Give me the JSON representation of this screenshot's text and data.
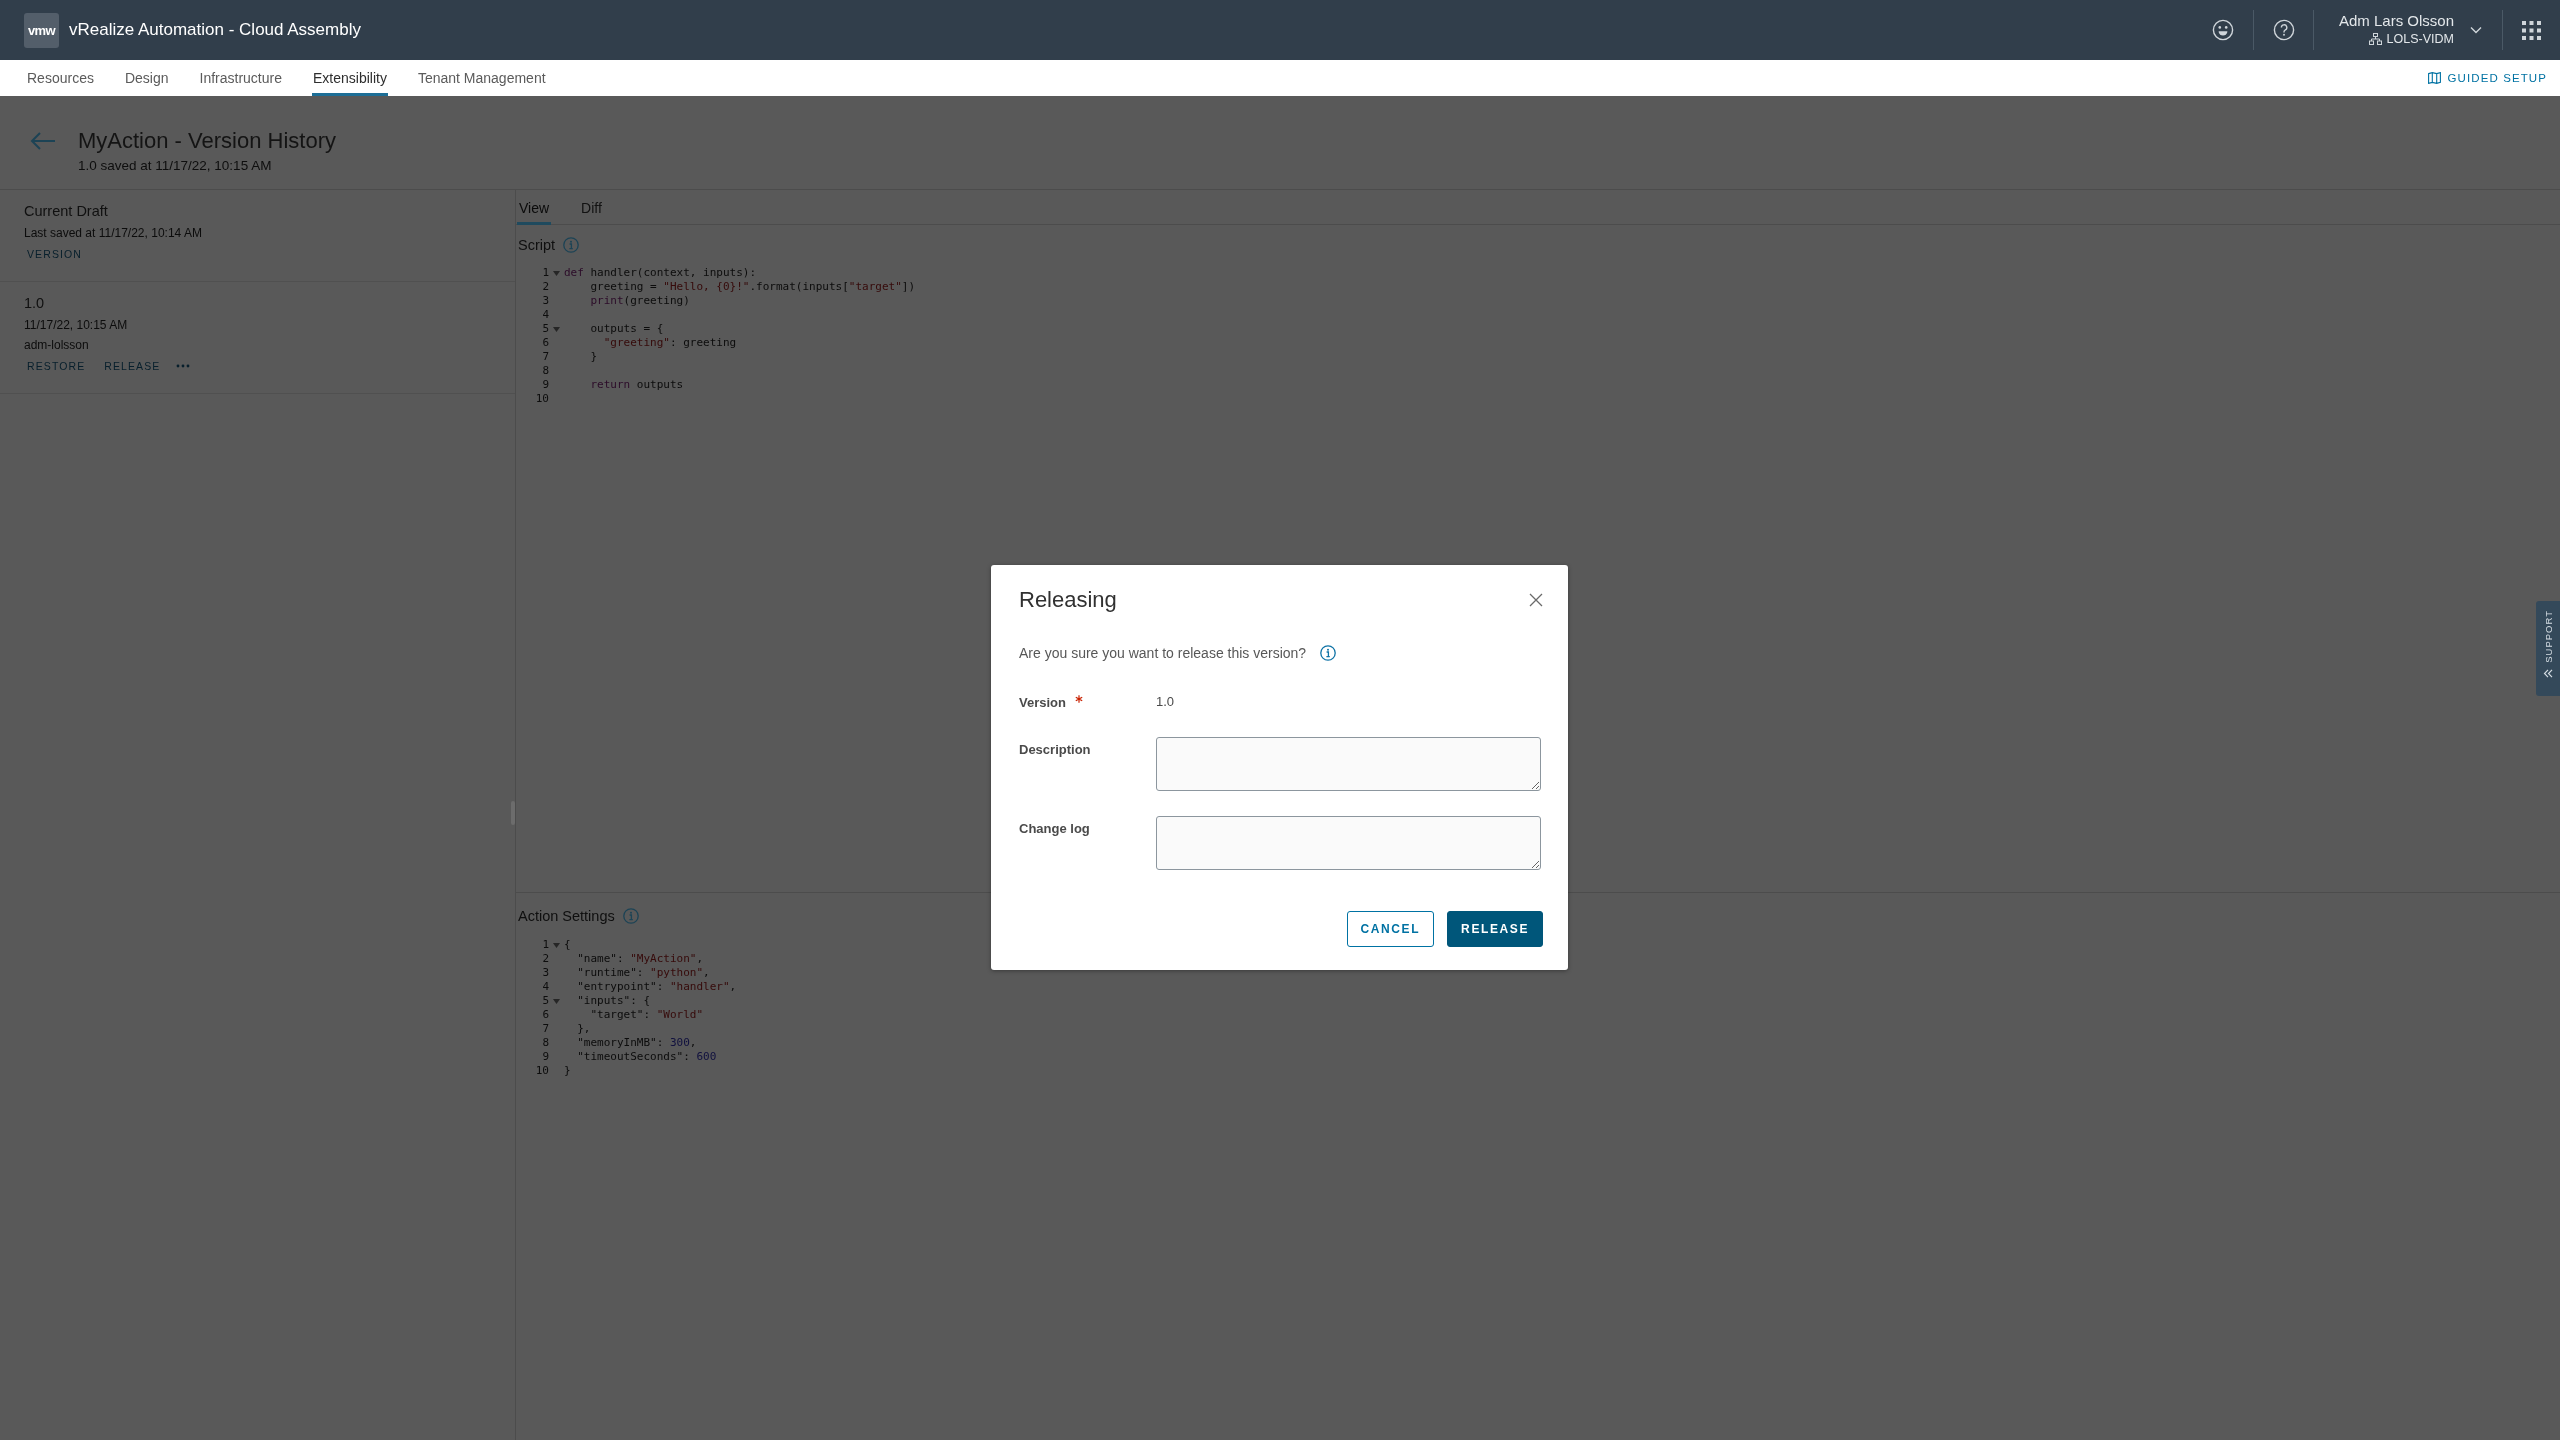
{
  "header": {
    "logo": "vmw",
    "title": "vRealize Automation - Cloud Assembly",
    "user": {
      "name": "Adm Lars Olsson",
      "org": "LOLS-VIDM"
    }
  },
  "nav": {
    "tabs": [
      {
        "label": "Resources",
        "selected": false
      },
      {
        "label": "Design",
        "selected": false
      },
      {
        "label": "Infrastructure",
        "selected": false
      },
      {
        "label": "Extensibility",
        "selected": true
      },
      {
        "label": "Tenant Management",
        "selected": false
      }
    ],
    "guided_setup": "GUIDED SETUP"
  },
  "page": {
    "title": "MyAction - Version History",
    "subtitle": "1.0 saved at 11/17/22, 10:15 AM"
  },
  "versions": [
    {
      "title": "Current Draft",
      "details": [
        "Last saved at 11/17/22, 10:14 AM"
      ],
      "actions": [
        "VERSION"
      ],
      "more": false
    },
    {
      "title": "1.0",
      "details": [
        "11/17/22, 10:15 AM",
        "adm-lolsson"
      ],
      "actions": [
        "RESTORE",
        "RELEASE"
      ],
      "more": true
    }
  ],
  "view_tabs": [
    {
      "label": "View",
      "selected": true
    },
    {
      "label": "Diff",
      "selected": false
    }
  ],
  "script": {
    "label": "Script",
    "lines": [
      {
        "number": "1",
        "fold": true,
        "tokens": [
          {
            "text": "def",
            "kind": "keyword"
          },
          {
            "text": " handler(context, inputs):",
            "kind": "plain"
          }
        ]
      },
      {
        "number": "2",
        "fold": false,
        "tokens": [
          {
            "text": "    greeting = ",
            "kind": "plain"
          },
          {
            "text": "\"Hello, {0}!\"",
            "kind": "string"
          },
          {
            "text": ".format(inputs[",
            "kind": "plain"
          },
          {
            "text": "\"target\"",
            "kind": "string"
          },
          {
            "text": "])",
            "kind": "plain"
          }
        ]
      },
      {
        "number": "3",
        "fold": false,
        "tokens": [
          {
            "text": "    print",
            "kind": "keyword"
          },
          {
            "text": "(greeting)",
            "kind": "plain"
          }
        ]
      },
      {
        "number": "4",
        "fold": false
      },
      {
        "number": "5",
        "fold": true,
        "tokens": [
          {
            "text": "    outputs = {",
            "kind": "plain"
          }
        ]
      },
      {
        "number": "6",
        "fold": false,
        "tokens": [
          {
            "text": "      \"greeting\"",
            "kind": "string"
          },
          {
            "text": ": greeting",
            "kind": "plain"
          }
        ]
      },
      {
        "number": "7",
        "fold": false,
        "tokens": [
          {
            "text": "    }",
            "kind": "plain"
          }
        ]
      },
      {
        "number": "8",
        "fold": false
      },
      {
        "number": "9",
        "fold": false,
        "tokens": [
          {
            "text": "    return",
            "kind": "keyword"
          },
          {
            "text": " outputs",
            "kind": "plain"
          }
        ]
      },
      {
        "number": "10",
        "fold": false
      }
    ]
  },
  "action_settings": {
    "label": "Action Settings",
    "lines": [
      {
        "number": "1",
        "fold": true,
        "tokens": [
          {
            "text": "{",
            "kind": "plain"
          }
        ]
      },
      {
        "number": "2",
        "fold": false,
        "tokens": [
          {
            "text": "  \"name\": ",
            "kind": "plain"
          },
          {
            "text": "\"MyAction\"",
            "kind": "string"
          },
          {
            "text": ",",
            "kind": "plain"
          }
        ]
      },
      {
        "number": "3",
        "fold": false,
        "tokens": [
          {
            "text": "  \"runtime\": ",
            "kind": "plain"
          },
          {
            "text": "\"python\"",
            "kind": "string"
          },
          {
            "text": ",",
            "kind": "plain"
          }
        ]
      },
      {
        "number": "4",
        "fold": false,
        "tokens": [
          {
            "text": "  \"entrypoint\": ",
            "kind": "plain"
          },
          {
            "text": "\"handler\"",
            "kind": "string"
          },
          {
            "text": ",",
            "kind": "plain"
          }
        ]
      },
      {
        "number": "5",
        "fold": true,
        "tokens": [
          {
            "text": "  \"inputs\": {",
            "kind": "plain"
          }
        ]
      },
      {
        "number": "6",
        "fold": false,
        "tokens": [
          {
            "text": "    \"target\": ",
            "kind": "plain"
          },
          {
            "text": "\"World\"",
            "kind": "string"
          }
        ]
      },
      {
        "number": "7",
        "fold": false,
        "tokens": [
          {
            "text": "  },",
            "kind": "plain"
          }
        ]
      },
      {
        "number": "8",
        "fold": false,
        "tokens": [
          {
            "text": "  \"memoryInMB\": ",
            "kind": "plain"
          },
          {
            "text": "300",
            "kind": "number"
          },
          {
            "text": ",",
            "kind": "plain"
          }
        ]
      },
      {
        "number": "9",
        "fold": false,
        "tokens": [
          {
            "text": "  \"timeoutSeconds\": ",
            "kind": "plain"
          },
          {
            "text": "600",
            "kind": "number"
          }
        ]
      },
      {
        "number": "10",
        "fold": false,
        "tokens": [
          {
            "text": "}",
            "kind": "plain"
          }
        ]
      }
    ]
  },
  "dialog": {
    "title": "Releasing",
    "message": "Are you sure you want to release this version?",
    "fields": [
      {
        "kind": "value",
        "label": "Version",
        "required": true,
        "value": "1.0"
      },
      {
        "kind": "textarea",
        "label": "Description",
        "required": false
      },
      {
        "kind": "textarea",
        "label": "Change log",
        "required": false
      }
    ],
    "buttons": [
      {
        "kind": "cancel",
        "label": "CANCEL"
      },
      {
        "kind": "confirm",
        "label": "RELEASE"
      }
    ]
  },
  "support_tab": {
    "label": "SUPPORT"
  }
}
